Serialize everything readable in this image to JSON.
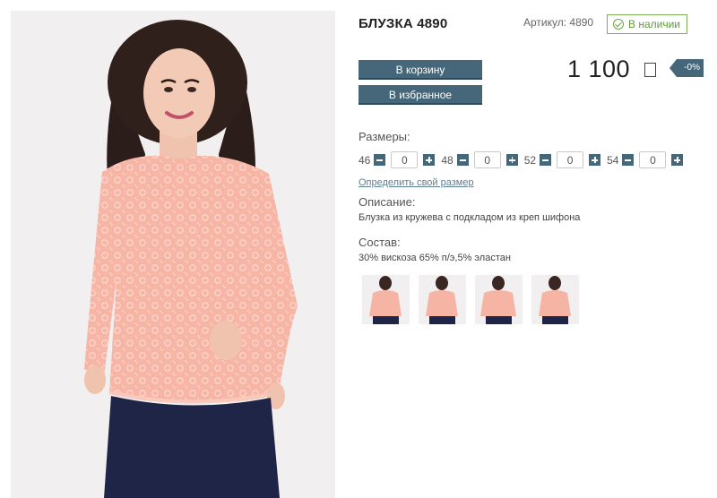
{
  "product": {
    "title": "БЛУЗКА 4890",
    "sku": "Артикул: 4890",
    "stock": "В наличии",
    "price": "1 100",
    "discount": "-0%"
  },
  "buttons": {
    "cart": "В корзину",
    "favorites": "В избранное"
  },
  "sizes": {
    "label": "Размеры:",
    "items": [
      {
        "size": "46",
        "qty": "0"
      },
      {
        "size": "48",
        "qty": "0"
      },
      {
        "size": "52",
        "qty": "0"
      },
      {
        "size": "54",
        "qty": "0"
      }
    ],
    "link": "Определить свой размер"
  },
  "description": {
    "label": "Описание:",
    "text": "Блузка из кружева с подкладом из креп шифона"
  },
  "composition": {
    "label": "Состав:",
    "text": "30% вискоза 65% п/э,5% эластан"
  },
  "colors": {
    "accent": "#46677a",
    "in_stock": "#5f9a3c",
    "blouse": "#f6b4a4",
    "skirt": "#1f2547"
  }
}
